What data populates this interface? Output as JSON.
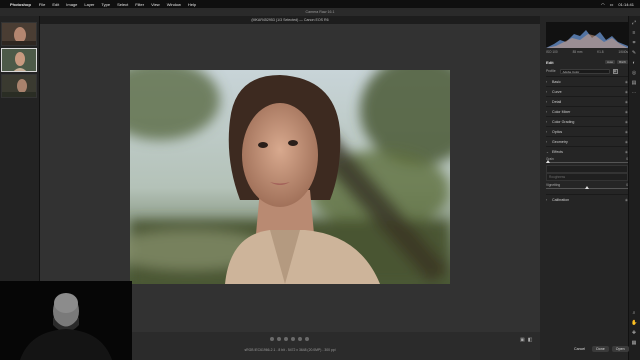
{
  "menubar": {
    "app": "Photoshop",
    "items": [
      "File",
      "Edit",
      "Image",
      "Layer",
      "Type",
      "Select",
      "Filter",
      "View",
      "Window",
      "Help"
    ],
    "clock": "01:14:41"
  },
  "window": {
    "title": "Camera Raw 16.1",
    "selection_info": "(MKAR452953 (1/3 Selected)",
    "camera": "Canon EOS R6"
  },
  "status": {
    "text": "sRGB IEC61966-2.1 - 8 bit - 5472 x 3648 (20.0MP) - 300 ppi"
  },
  "histogram": {
    "labels": [
      "ISO 100",
      "85 mm",
      "f/1.8",
      "1/640s"
    ]
  },
  "edit_panel": {
    "title": "Edit",
    "btn_auto": "Auto",
    "btn_bw": "B&W",
    "profile_label": "Profile",
    "profile_value": "Adobe Color",
    "sections": [
      "Basic",
      "Curve",
      "Detail",
      "Color Mixer",
      "Color Grading",
      "Optics",
      "Geometry",
      "Effects"
    ],
    "grain_label": "Grain",
    "grain_value": "0",
    "sub_box_1": "",
    "sub_box_2": "Roughness",
    "vignetting_label": "Vignetting",
    "vignetting_value": "0",
    "calibration": "Calibration"
  },
  "footer": {
    "cancel": "Cancel",
    "done": "Done",
    "open": "Open"
  },
  "colors": {
    "accent": "#dcdcdc"
  }
}
